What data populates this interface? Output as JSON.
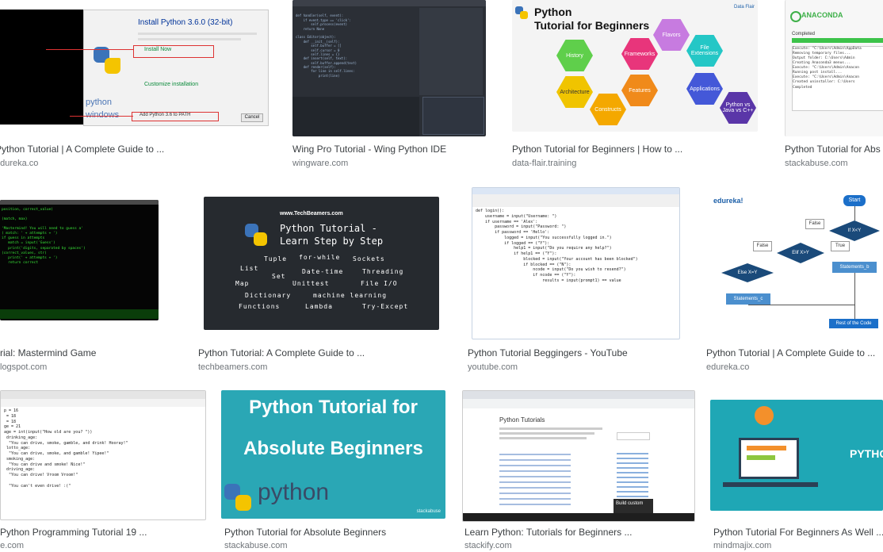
{
  "results": [
    {
      "title": "Python Tutorial | A Complete Guide to ...",
      "source": "edureka.co"
    },
    {
      "title": "Wing Pro Tutorial - Wing Python IDE",
      "source": "wingware.com"
    },
    {
      "title": "Python Tutorial for Beginners | How to ...",
      "source": "data-flair.training"
    },
    {
      "title": "Python Tutorial for Abs",
      "source": "stackabuse.com"
    },
    {
      "title": "rial: Mastermind Game",
      "source": "logspot.com"
    },
    {
      "title": "Python Tutorial: A Complete Guide to ...",
      "source": "techbeamers.com"
    },
    {
      "title": "Python Tutorial Beggingers - YouTube",
      "source": "youtube.com"
    },
    {
      "title": "Python Tutorial | A Complete Guide to ...",
      "source": "edureka.co"
    },
    {
      "title": "Python Programming Tutorial 19 ...",
      "source": "ee.com"
    },
    {
      "title": "Python Tutorial for Absolute Beginners",
      "source": "stackabuse.com"
    },
    {
      "title": "Learn Python: Tutorials for Beginners ...",
      "source": "stackify.com"
    },
    {
      "title": "Python Tutorial For Beginners As Well ...",
      "source": "mindmajix.com"
    }
  ],
  "thumbs": {
    "t1": {
      "heading": "Install Python 3.6.0 (32-bit)",
      "install_now": "Install Now",
      "customize": "Customize installation",
      "add_path": "Add Python 3.6 to PATH",
      "cancel": "Cancel",
      "logo_word1": "python",
      "logo_word2": "windows"
    },
    "t3": {
      "brand": "Python",
      "subtitle": "Tutorial for Beginners",
      "badge": "Data Flair",
      "hexes": [
        "Flavors",
        "History",
        "Frameworks",
        "File Extensions",
        "Architecture",
        "Features",
        "Applications",
        "Constructs",
        "Python vs Java vs C++"
      ]
    },
    "t4": {
      "brand": "ANACONDA",
      "completed": "Completed"
    },
    "t6": {
      "site": "www.TechBeamers.com",
      "line1": "Python Tutorial -",
      "line2": "Learn Step by Step",
      "words": [
        "Tuple",
        "for-while",
        "Sockets",
        "List",
        "Set",
        "Date-time",
        "Threading",
        "Map",
        "Unittest",
        "File I/O",
        "Dictionary",
        "machine learning",
        "Functions",
        "Lambda",
        "Try-Except"
      ]
    },
    "t8": {
      "brand": "edureka!",
      "start": "Start",
      "ifxy": "If X<Y",
      "elifxy": "Elif X>Y",
      "elsexy": "Else X=Y",
      "false1": "False",
      "false2": "False",
      "true1": "True",
      "stmt_b": "Statements_b",
      "stmt_c": "Statements_c",
      "rest": "Rest of the Code"
    },
    "t10": {
      "line1": "Python Tutorial for",
      "line2": "Absolute Beginners",
      "logo": "python",
      "site": "stackabuse"
    },
    "t11": {
      "heading": "Python Tutorials",
      "banner": "Build custom"
    },
    "t12": {
      "brand": "PYTHO"
    }
  }
}
